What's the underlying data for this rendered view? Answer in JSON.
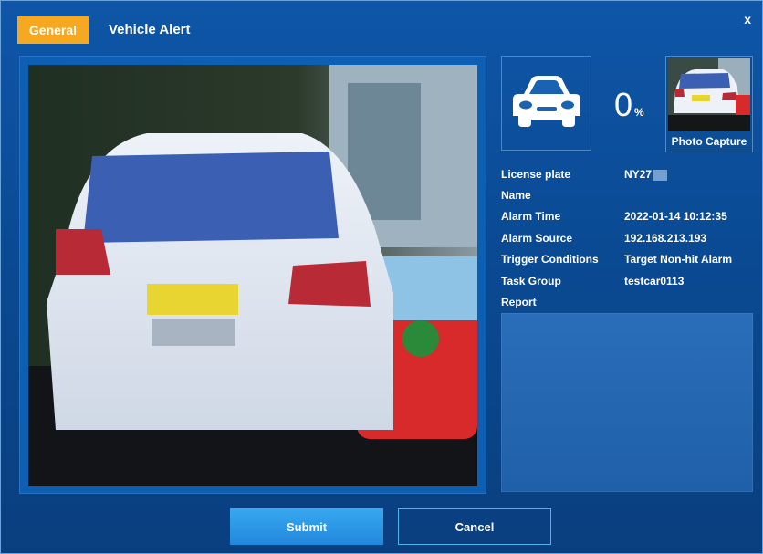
{
  "tabs": {
    "general": "General",
    "vehicle_alert": "Vehicle Alert"
  },
  "close_label": "x",
  "score": {
    "value": "0",
    "unit": "%"
  },
  "photo_capture_label": "Photo Capture",
  "fields": [
    {
      "label": "License plate",
      "value": "NY27"
    },
    {
      "label": "Name",
      "value": ""
    },
    {
      "label": "Alarm Time",
      "value": "2022-01-14 10:12:35"
    },
    {
      "label": "Alarm Source",
      "value": "192.168.213.193"
    },
    {
      "label": "Trigger Conditions",
      "value": "Target Non-hit Alarm"
    },
    {
      "label": "Task Group",
      "value": "testcar0113"
    },
    {
      "label": "Report",
      "value": ""
    }
  ],
  "buttons": {
    "submit": "Submit",
    "cancel": "Cancel"
  },
  "colors": {
    "accent_tab": "#f6a821",
    "dialog_bg": "#0f56a8",
    "submit_bg": "#2288dc"
  }
}
